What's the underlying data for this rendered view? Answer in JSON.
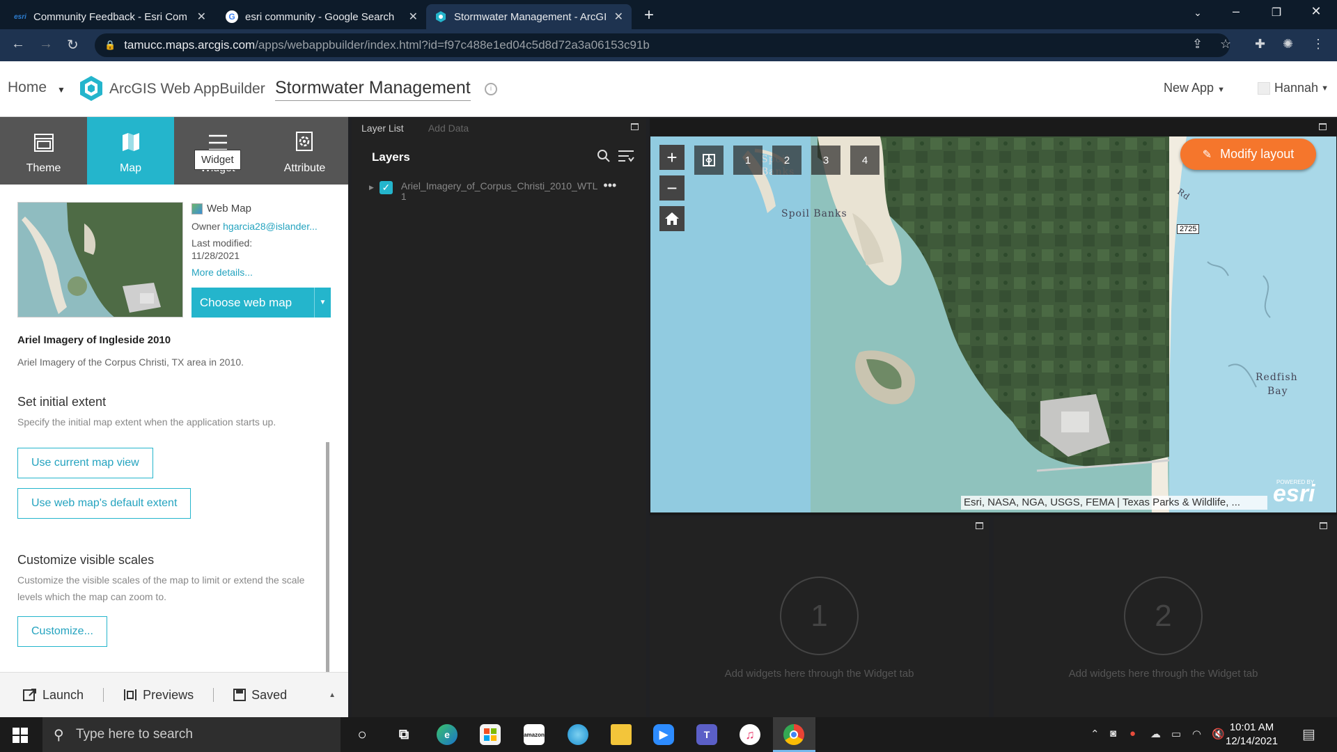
{
  "browser": {
    "tabs": [
      {
        "favicon": "esri",
        "title": "Community Feedback - Esri Com"
      },
      {
        "favicon": "G",
        "title": "esri community - Google Search"
      },
      {
        "favicon": "webappbuilder-icon",
        "title": "Stormwater Management - ArcGI"
      }
    ],
    "url_host": "tamucc.maps.arcgis.com",
    "url_path": "/apps/webappbuilder/index.html?id=f97c488e1ed04c5d8d72a3a06153c91b"
  },
  "header": {
    "home": "Home",
    "app_name": "ArcGIS Web AppBuilder",
    "title": "Stormwater Management",
    "new_app": "New App",
    "user": "Hannah"
  },
  "left_tabs": [
    {
      "label": "Theme",
      "icon": "theme-icon"
    },
    {
      "label": "Map",
      "icon": "map-icon"
    },
    {
      "label": "Widget",
      "icon": "widget-icon"
    },
    {
      "label": "Attribute",
      "icon": "attribute-icon"
    }
  ],
  "tooltip": "Widget",
  "webmap": {
    "type_label": "Web Map",
    "owner_label": "Owner",
    "owner": "hgarcia28@islander...",
    "last_modified_label": "Last modified:",
    "last_modified": "11/28/2021",
    "more_details": "More details...",
    "choose_button": "Choose web map",
    "name": "Ariel Imagery of Ingleside 2010",
    "description": "Ariel Imagery of the Corpus Christi, TX area in 2010."
  },
  "extent": {
    "title": "Set initial extent",
    "description": "Specify the initial map extent when the application starts up.",
    "button_current": "Use current map view",
    "button_default": "Use web map's default extent"
  },
  "scales": {
    "title": "Customize visible scales",
    "description": "Customize the visible scales of the map to limit or extend the scale levels which the map can zoom to.",
    "button": "Customize..."
  },
  "footer": {
    "launch": "Launch",
    "previews": "Previews",
    "saved": "Saved"
  },
  "layer_list": {
    "tab_layer_list": "Layer List",
    "tab_add_data": "Add Data",
    "title": "Layers",
    "layer_name_line1": "Ariel_Imagery_of_Corpus_Christi_2010_WTL",
    "layer_name_line2": "1",
    "layer_checked": true
  },
  "map": {
    "bookmarks": [
      "1",
      "2",
      "3",
      "4"
    ],
    "modify_layout": "Modify layout",
    "attribution": "Esri, NASA, NGA, USGS, FEMA | Texas Parks & Wildlife, ...",
    "labels": {
      "spoil_banks": "Spoil Banks",
      "redfish": "Redfish",
      "bay": "Bay",
      "road": "Rd",
      "shield": "2725",
      "powered_by": "POWERED BY",
      "esri": "esri"
    }
  },
  "placeholders": [
    {
      "number": "1",
      "text": "Add widgets here through the Widget tab"
    },
    {
      "number": "2",
      "text": "Add widgets here through the Widget tab"
    }
  ],
  "taskbar": {
    "search_placeholder": "Type here to search",
    "time": "10:01 AM",
    "date": "12/14/2021"
  },
  "colors": {
    "accent": "#24b5cc",
    "modify_button": "#f5762c",
    "browser_frame": "#0d1b2a"
  }
}
